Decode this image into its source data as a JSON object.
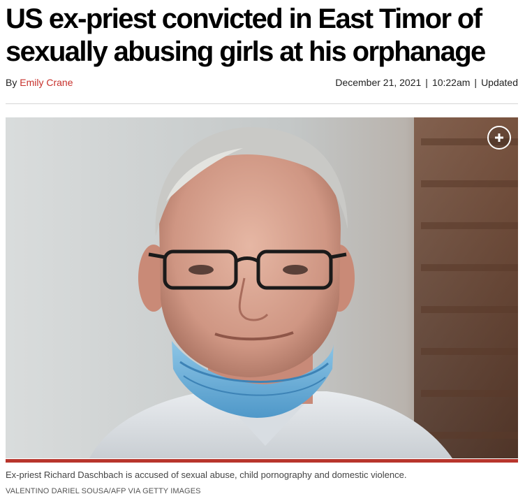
{
  "article": {
    "headline": "US ex-priest convicted in East Timor of sexually abusing girls at his orphanage",
    "byline_prefix": "By",
    "author": "Emily Crane",
    "date": "December 21, 2021",
    "time": "10:22am",
    "updated_label": "Updated",
    "separator": "|"
  },
  "image": {
    "expand_icon": "plus-circle-icon",
    "caption": "Ex-priest Richard Daschbach is accused of sexual abuse, child pornography and domestic violence.",
    "credit": "VALENTINO DARIEL SOUSA/AFP via Getty Images"
  },
  "colors": {
    "author_link": "#c7302b",
    "caption_bar": "#b8352c"
  }
}
